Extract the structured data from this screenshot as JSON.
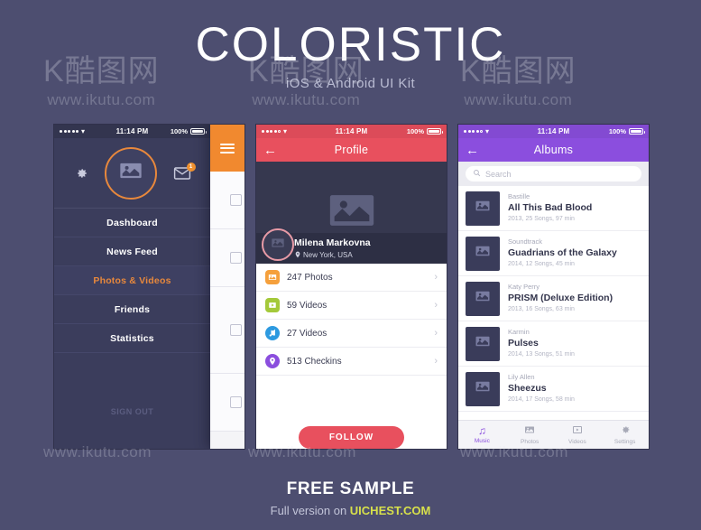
{
  "hero": {
    "title": "COLORISTIC",
    "subtitle": "iOS & Android UI Kit"
  },
  "footer": {
    "free_sample": "FREE SAMPLE",
    "full_version_prefix": "Full version on ",
    "full_version_site": "UICHEST.COM"
  },
  "watermark": {
    "logo": "K酷图网",
    "url": "www.ikutu.com"
  },
  "statusbar": {
    "time": "11:14 PM",
    "battery": "100%"
  },
  "colors": {
    "page_background": "#4d4e70",
    "drawer_background": "#3b3d5c",
    "orange_accent": "#f1892f",
    "red_accent": "#e8505e",
    "purple_accent": "#8b4ede",
    "footer_link": "#d7e04b"
  },
  "screen_drawer": {
    "avatar_icon": "photo-placeholder-icon",
    "gear_icon": "gear-icon",
    "mail_icon": "mail-icon",
    "mail_badge": "1",
    "menu_items": [
      {
        "label": "Dashboard",
        "active": false
      },
      {
        "label": "News Feed",
        "active": false
      },
      {
        "label": "Photos & Videos",
        "active": true
      },
      {
        "label": "Friends",
        "active": false
      },
      {
        "label": "Statistics",
        "active": false
      }
    ],
    "signout_label": "SIGN OUT",
    "hamburger_icon": "hamburger-menu-icon"
  },
  "screen_profile": {
    "title": "Profile",
    "back_icon": "back-arrow-icon",
    "cover_icon": "photo-placeholder-icon",
    "avatar_icon": "photo-placeholder-icon",
    "user_name": "Milena Markovna",
    "user_location": "New York, USA",
    "location_icon": "map-pin-icon",
    "stats": [
      {
        "label": "247 Photos",
        "icon": "photo-icon",
        "color": "#f5a03c"
      },
      {
        "label": "59 Videos",
        "icon": "video-icon",
        "color": "#a4c93a"
      },
      {
        "label": "27 Videos",
        "icon": "music-note-icon",
        "color": "#2d9ae0"
      },
      {
        "label": "513 Checkins",
        "icon": "map-pin-icon",
        "color": "#8b4ede"
      }
    ],
    "follow_label": "FOLLOW",
    "chevron_icon": "chevron-right-icon"
  },
  "screen_albums": {
    "title": "Albums",
    "back_icon": "back-arrow-icon",
    "search_placeholder": "Search",
    "search_icon": "search-icon",
    "albums": [
      {
        "artist": "Bastille",
        "title": "All This Bad Blood",
        "info": "2013, 25 Songs, 97 min"
      },
      {
        "artist": "Soundtrack",
        "title": "Guadrians of the Galaxy",
        "info": "2014, 12 Songs, 45 min"
      },
      {
        "artist": "Katy Perry",
        "title": "PRISM (Deluxe Edition)",
        "info": "2013, 16 Songs, 63 min"
      },
      {
        "artist": "Karmin",
        "title": "Pulses",
        "info": "2014, 13 Songs, 51 min"
      },
      {
        "artist": "Lily Allen",
        "title": "Sheezus",
        "info": "2014, 17 Songs, 58 min"
      }
    ],
    "tabs": [
      {
        "label": "Music",
        "icon": "music-note-icon",
        "active": true
      },
      {
        "label": "Photos",
        "icon": "photo-icon",
        "active": false
      },
      {
        "label": "Videos",
        "icon": "video-icon",
        "active": false
      },
      {
        "label": "Settings",
        "icon": "gear-icon",
        "active": false
      }
    ]
  }
}
